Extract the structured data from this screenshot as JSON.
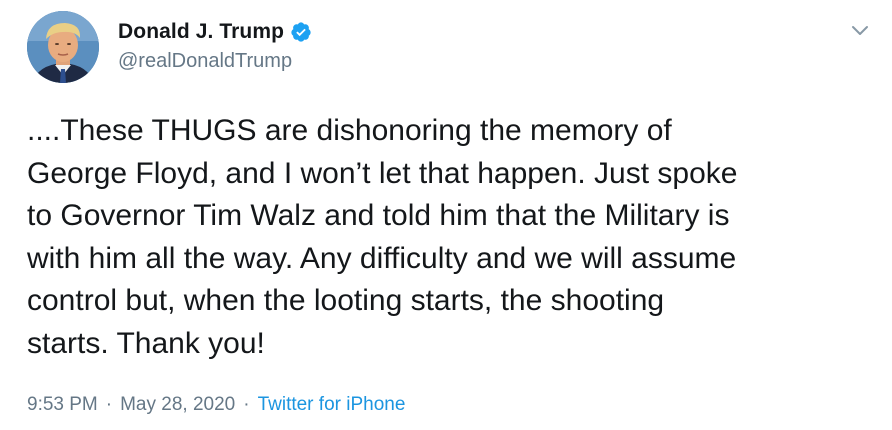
{
  "tweet": {
    "author": {
      "display_name": "Donald J. Trump",
      "handle": "@realDonaldTrump",
      "verified": true,
      "verified_icon": "verified-badge-icon",
      "avatar_icon": "profile-avatar"
    },
    "menu_icon": "chevron-down-icon",
    "text": "....These THUGS are dishonoring the memory of\nGeorge Floyd, and I won’t let that happen. Just spoke\nto Governor Tim Walz and told him that the Military is\nwith him all the way. Any difficulty and we will assume\ncontrol but, when the looting starts, the shooting\nstarts. Thank you!",
    "time": "9:53 PM",
    "separator_1": "·",
    "date": "May 28, 2020",
    "separator_2": "·",
    "source": "Twitter for iPhone"
  },
  "colors": {
    "text_primary": "#14171a",
    "text_secondary": "#657786",
    "link": "#1b95e0",
    "verified": "#1da1f2",
    "background": "#ffffff"
  }
}
